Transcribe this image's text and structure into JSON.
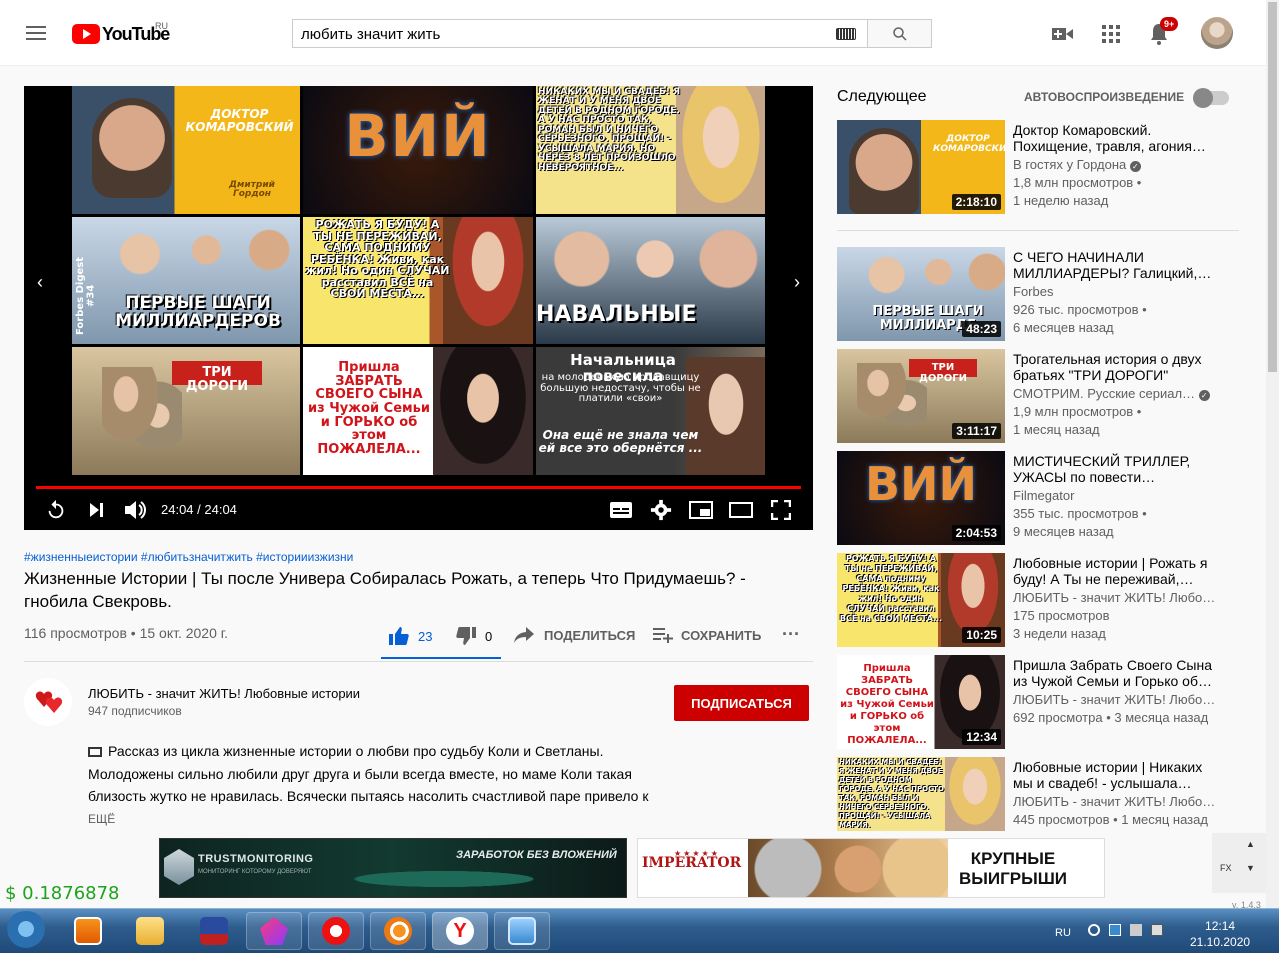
{
  "header": {
    "logo_text": "YouTube",
    "logo_region": "RU",
    "search_value": "любить значит жить",
    "notification_count": "9+"
  },
  "player": {
    "time": "24:04 / 24:04",
    "progress": 1.0,
    "endscreen": [
      {
        "text": "ДОКТОР КОМАРОВСКИЙ",
        "sub": "Дмитрий Гордон"
      },
      {
        "text": "ВИЙ"
      },
      {
        "text": "НИКАКИХ МЫ И СВАДЕБ! Я ЖЕНАТ И У МЕНЯ ДВОЕ ДЕТЕЙ В РОДНОМ ГОРОДЕ. А У НАС ПРОСТО ТАК, РОМАН БЫЛ И НИЧЕГО СЕРЬЕЗНОГО. ПРОЩАЙ! - УСЫШАЛА МАРИЯ. НО ЧЕРЕЗ 8 ЛЕТ ПРОИЗОШЛО НЕВЕРОЯТНОЕ..."
      },
      {
        "text": "ПЕРВЫЕ ШАГИ МИЛЛИАРДЕРОВ",
        "sub": "Forbes Digest #34"
      },
      {
        "text": "РОЖАТЬ Я БУДУ! А ТЫ НЕ ПЕРЕЖИВАЙ, САМА ПОДНИМУ РЕБЁНКА! Живи, как жил! Но один СЛУЧАЙ расставил ВСЁ на СВОИ МЕСТА..."
      },
      {
        "text": "НАВАЛЬНЫЕ"
      },
      {
        "text": "ТРИ ДОРОГИ"
      },
      {
        "text": "Пришла ЗАБРАТЬ СВОЕГО СЫНА из Чужой Семьи и ГОРЬКО об этом ПОЖАЛЕЛА..."
      },
      {
        "text": "Начальница повесила",
        "sub": "на молоденькую продавщицу большую недостачу, чтобы не платили «свои»",
        "sub2": "Она ещё не знала чем ей все это обернётся ..."
      }
    ]
  },
  "video": {
    "tags": "#жизненныеистории #любитьзначитжить #историиизжизни",
    "title": "Жизненные Истории | Ты после Универа Собиралась Рожать, а теперь Что Придумаешь? - гнобила Свекровь.",
    "views_date": "116 просмотров • 15 окт. 2020 г.",
    "likes": "23",
    "dislikes": "0",
    "like_ratio": 1.0,
    "share_label": "ПОДЕЛИТЬСЯ",
    "save_label": "СОХРАНИТЬ"
  },
  "channel": {
    "name": "ЛЮБИТЬ - значит ЖИТЬ! Любовные истории",
    "subscribers": "947 подписчиков",
    "subscribe_label": "ПОДПИСАТЬСЯ"
  },
  "description": {
    "text": "Рассказ из цикла жизненные истории о любви про судьбу Коли и Светланы. Молодожены сильно любили друг друга и были всегда вместе, но маме Коли такая близость жутко не нравилась. Всячески пытаясь насолить счастливой паре привело к",
    "more_label": "ЕЩЁ"
  },
  "sidebar": {
    "up_next_label": "Следующее",
    "autoplay_label": "АВТОВОСПРОИЗВЕДЕНИЕ",
    "items": [
      {
        "title": "Доктор Комаровский. Похищение, травля, агония…",
        "channel": "В гостях у Гордона",
        "verified": true,
        "views": "1,8 млн просмотров •",
        "age": "1 неделю назад",
        "duration": "2:18:10",
        "thumb_text": "ДОКТОР КОМАРОВСКИЙ"
      },
      {
        "title": "С ЧЕГО НАЧИНАЛИ МИЛЛИАРДЕРЫ? Галицкий,…",
        "channel": "Forbes",
        "verified": false,
        "views": "926 тыс. просмотров •",
        "age": "6 месяцев назад",
        "duration": "48:23",
        "thumb_text": "ПЕРВЫЕ ШАГИ МИЛЛИАРДЕ"
      },
      {
        "title": "Трогательная история о двух братьях \"ТРИ ДОРОГИ\"",
        "channel": "СМОТРИМ. Русские сериал…",
        "verified": true,
        "views": "1,9 млн просмотров •",
        "age": "1 месяц назад",
        "duration": "3:11:17",
        "thumb_text": "ТРИ ДОРОГИ"
      },
      {
        "title": "МИСТИЧЕСКИЙ ТРИЛЛЕР, УЖАСЫ по повести…",
        "channel": "Filmegator",
        "verified": false,
        "views": "355 тыс. просмотров •",
        "age": "9 месяцев назад",
        "duration": "2:04:53",
        "thumb_text": "ВИЙ"
      },
      {
        "title": "Любовные истории | Рожать я буду! А Ты не переживай,…",
        "channel": "ЛЮБИТЬ - значит ЖИТЬ! Любо…",
        "verified": false,
        "views": "175 просмотров",
        "age": "3 недели назад",
        "duration": "10:25",
        "thumb_text": "РОЖАТЬ Я БУДУ! А ТЫ не ПЕРЕЖИВАЙ, САМА подниму РЕБЁНКА! Живи, как жил! Но один СЛУЧАЙ расставил ВСЁ на СВОИ МЕСТА..."
      },
      {
        "title": "Пришла Забрать Своего Сына из Чужой Семьи и Горько об…",
        "channel": "ЛЮБИТЬ - значит ЖИТЬ! Любо…",
        "verified": false,
        "views": "692 просмотра • 3 месяца назад",
        "age": "",
        "duration": "12:34",
        "thumb_text": "Пришла ЗАБРАТЬ СВОЕГО СЫНА из Чужой Семьи и ГОРЬКО об этом ПОЖАЛЕЛА..."
      },
      {
        "title": "Любовные истории | Никаких мы и свадеб! - услышала…",
        "channel": "ЛЮБИТЬ - значит ЖИТЬ! Любо…",
        "verified": false,
        "views": "445 просмотров • 1 месяц назад",
        "age": "",
        "duration": "",
        "thumb_text": "НИКАКИХ МЫ И СВАДЕБ! Я ЖЕНАТ И У МЕНЯ ДВОЕ ДЕТЕЙ В РОДНОМ ГОРОДЕ. А У НАС ПРОСТО ТАК, РОМАН БЫЛ И НИЧЕГО СЕРЬЕЗНОГО. ПРОЩАЙ! - УСЫШАЛА МАРИЯ."
      }
    ]
  },
  "ads": {
    "ad1_brand": "TRUSTMONITORING",
    "ad1_tagline": "МОНИТОРИНГ КОТОРОМУ ДОВЕРЯЮТ",
    "ad1_text": "ЗАРАБОТОК БЕЗ ВЛОЖЕНИЙ",
    "ad2_brand": "IMPERATOR",
    "ad2_text": "КРУПНЫЕ ВЫИГРЫШИ"
  },
  "extension": {
    "price": "$ 0.1876878",
    "version": "v. 1.4.3",
    "fx_label": "FX"
  },
  "taskbar": {
    "language": "RU",
    "time": "12:14",
    "date": "21.10.2020"
  },
  "colors": {
    "brand_red": "#ff0000",
    "subscribe_red": "#cc0000",
    "link_blue": "#065fd4",
    "price_green": "#1ea31e"
  }
}
